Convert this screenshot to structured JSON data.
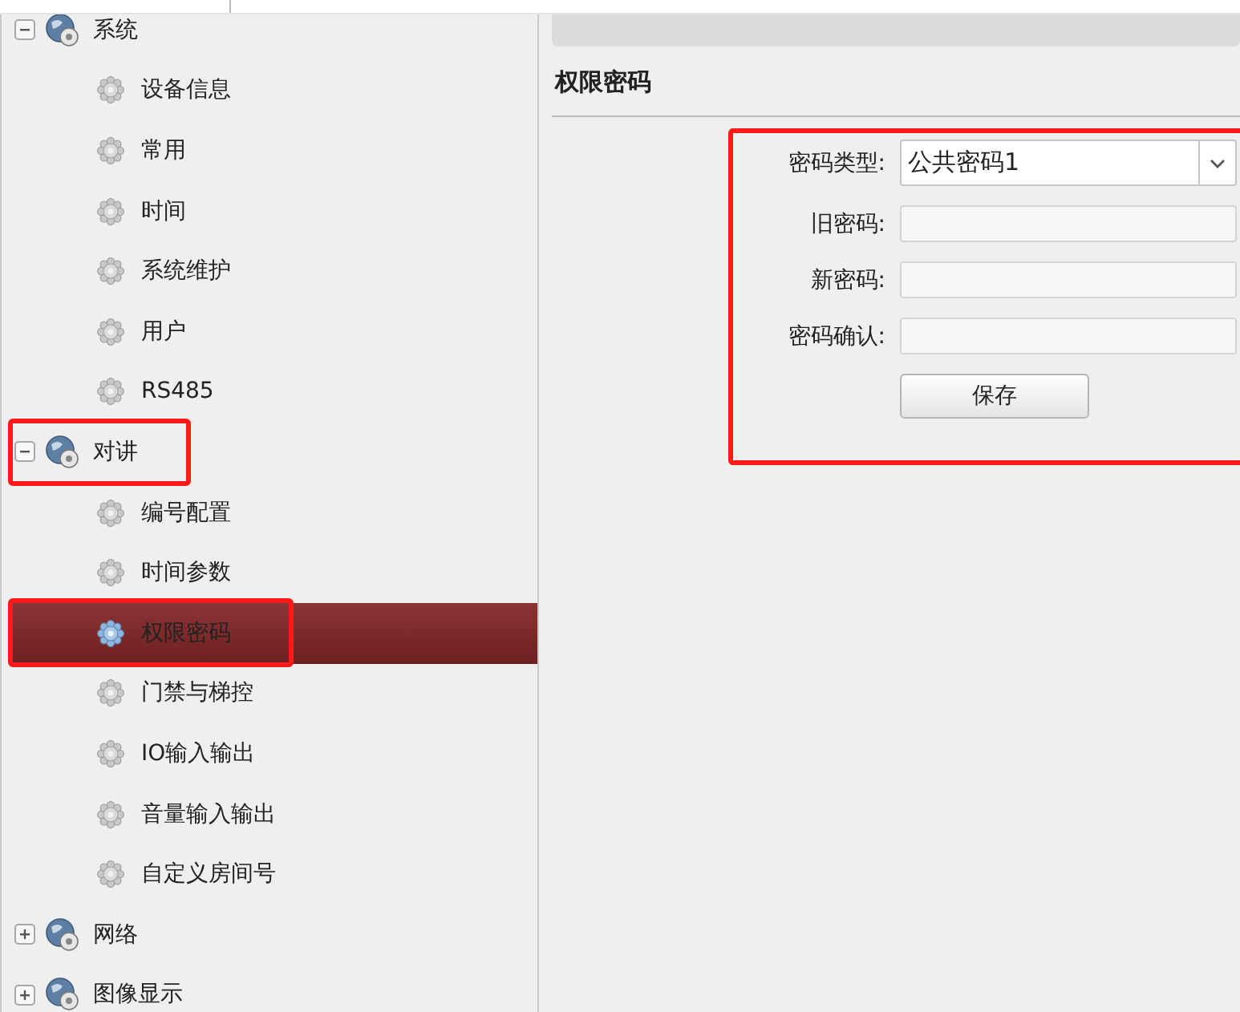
{
  "tree": [
    {
      "label": "系统",
      "expanded": true,
      "selected": false,
      "annotated": false,
      "children": [
        {
          "label": "设备信息",
          "selected": false,
          "annotated": false
        },
        {
          "label": "常用",
          "selected": false,
          "annotated": false
        },
        {
          "label": "时间",
          "selected": false,
          "annotated": false
        },
        {
          "label": "系统维护",
          "selected": false,
          "annotated": false
        },
        {
          "label": "用户",
          "selected": false,
          "annotated": false
        },
        {
          "label": "RS485",
          "selected": false,
          "annotated": false
        }
      ]
    },
    {
      "label": "对讲",
      "expanded": true,
      "selected": false,
      "annotated": true,
      "children": [
        {
          "label": "编号配置",
          "selected": false,
          "annotated": false
        },
        {
          "label": "时间参数",
          "selected": false,
          "annotated": false
        },
        {
          "label": "权限密码",
          "selected": true,
          "annotated": true
        },
        {
          "label": "门禁与梯控",
          "selected": false,
          "annotated": false
        },
        {
          "label": "IO输入输出",
          "selected": false,
          "annotated": false
        },
        {
          "label": "音量输入输出",
          "selected": false,
          "annotated": false
        },
        {
          "label": "自定义房间号",
          "selected": false,
          "annotated": false
        }
      ]
    },
    {
      "label": "网络",
      "expanded": false,
      "selected": false,
      "annotated": false
    },
    {
      "label": "图像显示",
      "expanded": false,
      "selected": false,
      "annotated": false
    }
  ],
  "panel": {
    "heading": "权限密码",
    "form": {
      "annotated": true,
      "fields": [
        {
          "kind": "select",
          "label": "密码类型:",
          "value": "公共密码1"
        },
        {
          "kind": "input",
          "label": "旧密码:"
        },
        {
          "kind": "input",
          "label": "新密码:"
        },
        {
          "kind": "input",
          "label": "密码确认:"
        }
      ],
      "save_button": "保存"
    }
  }
}
